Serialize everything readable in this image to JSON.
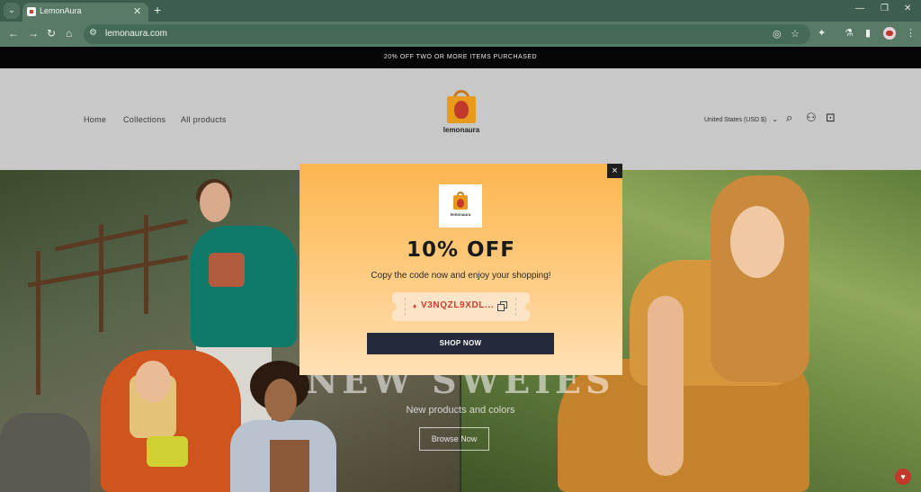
{
  "browser": {
    "tab_title": "LemonAura",
    "url": "lemonaura.com",
    "icons": [
      "tab-search-icon",
      "close-icon",
      "new-tab-icon",
      "minimize-icon",
      "restore-icon",
      "window-close-icon",
      "back-icon",
      "forward-icon",
      "reload-icon",
      "home-icon",
      "site-info-icon",
      "eye-off-icon",
      "star-icon",
      "extensions-icon",
      "lab-icon",
      "side-panel-icon",
      "profile-avatar",
      "menu-icon"
    ]
  },
  "announcement": "20% OFF TWO OR MORE ITEMS PURCHASED",
  "header": {
    "nav": [
      "Home",
      "Collections",
      "All products"
    ],
    "logo_text": "lemonaura",
    "country": "United States (USD $)",
    "icons": [
      "search-icon",
      "account-icon",
      "cart-icon"
    ]
  },
  "hero": {
    "title": "NEW SWEIES",
    "subtitle": "New products and colors",
    "button": "Browse Now"
  },
  "popup": {
    "logo_text": "lemonaura",
    "title": "10% OFF",
    "description": "Copy the code now and enjoy your shopping!",
    "coupon_code": "V3NQZL9XDL...",
    "button": "SHOP NOW",
    "close": "×"
  },
  "colors": {
    "tab_bar": "#3d5e4e",
    "address_bar": "#5a7a68",
    "announcement_bg": "#050505",
    "header_bg": "#c8c8c8",
    "popup_top": "#fbb64f",
    "coupon_text": "#d23b2e",
    "shop_button": "#232a3a"
  }
}
